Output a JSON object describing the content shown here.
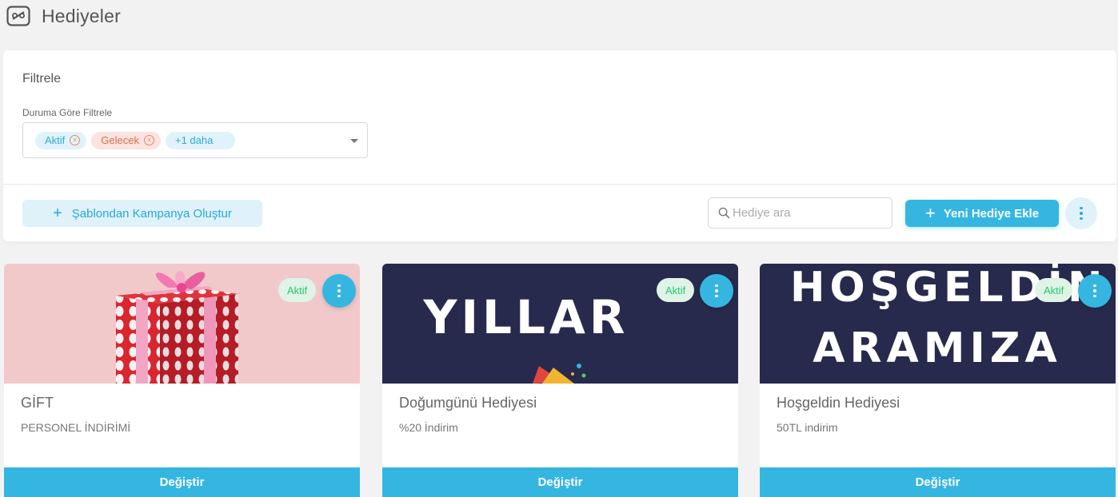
{
  "header": {
    "title": "Hediyeler",
    "icon": "gift-icon"
  },
  "filter": {
    "title": "Filtrele",
    "label": "Duruma Göre Filtrele",
    "chips": [
      {
        "label": "Aktif",
        "color": "#2fa8d6"
      },
      {
        "label": "Gelecek",
        "color": "#d2714f"
      }
    ],
    "more_label": "+1 daha"
  },
  "toolbar": {
    "template_button": "Şablondan Kampanya Oluştur",
    "search_placeholder": "Hediye ara",
    "new_button": "Yeni Hediye Ekle"
  },
  "cards": [
    {
      "title": "GİFT",
      "subtitle": "PERSONEL İNDİRİMİ",
      "status": "Aktif",
      "button": "Değiştir",
      "image": "gift-box-image"
    },
    {
      "title": "Doğumgünü Hediyesi",
      "subtitle": "%20 İndirim",
      "status": "Aktif",
      "button": "Değiştir",
      "image": "birthday-banner",
      "banner_text": [
        "YILLAR"
      ]
    },
    {
      "title": "Hoşgeldin Hediyesi",
      "subtitle": "50TL indirim",
      "status": "Aktif",
      "button": "Değiştir",
      "image": "welcome-banner",
      "banner_text": [
        "HOŞGELDİN",
        "ARAMIZA"
      ]
    }
  ],
  "colors": {
    "accent": "#35b6e0",
    "status_active_bg": "#dff3e6",
    "status_active_text": "#28c76f",
    "banner_bg": "#272a4c"
  }
}
